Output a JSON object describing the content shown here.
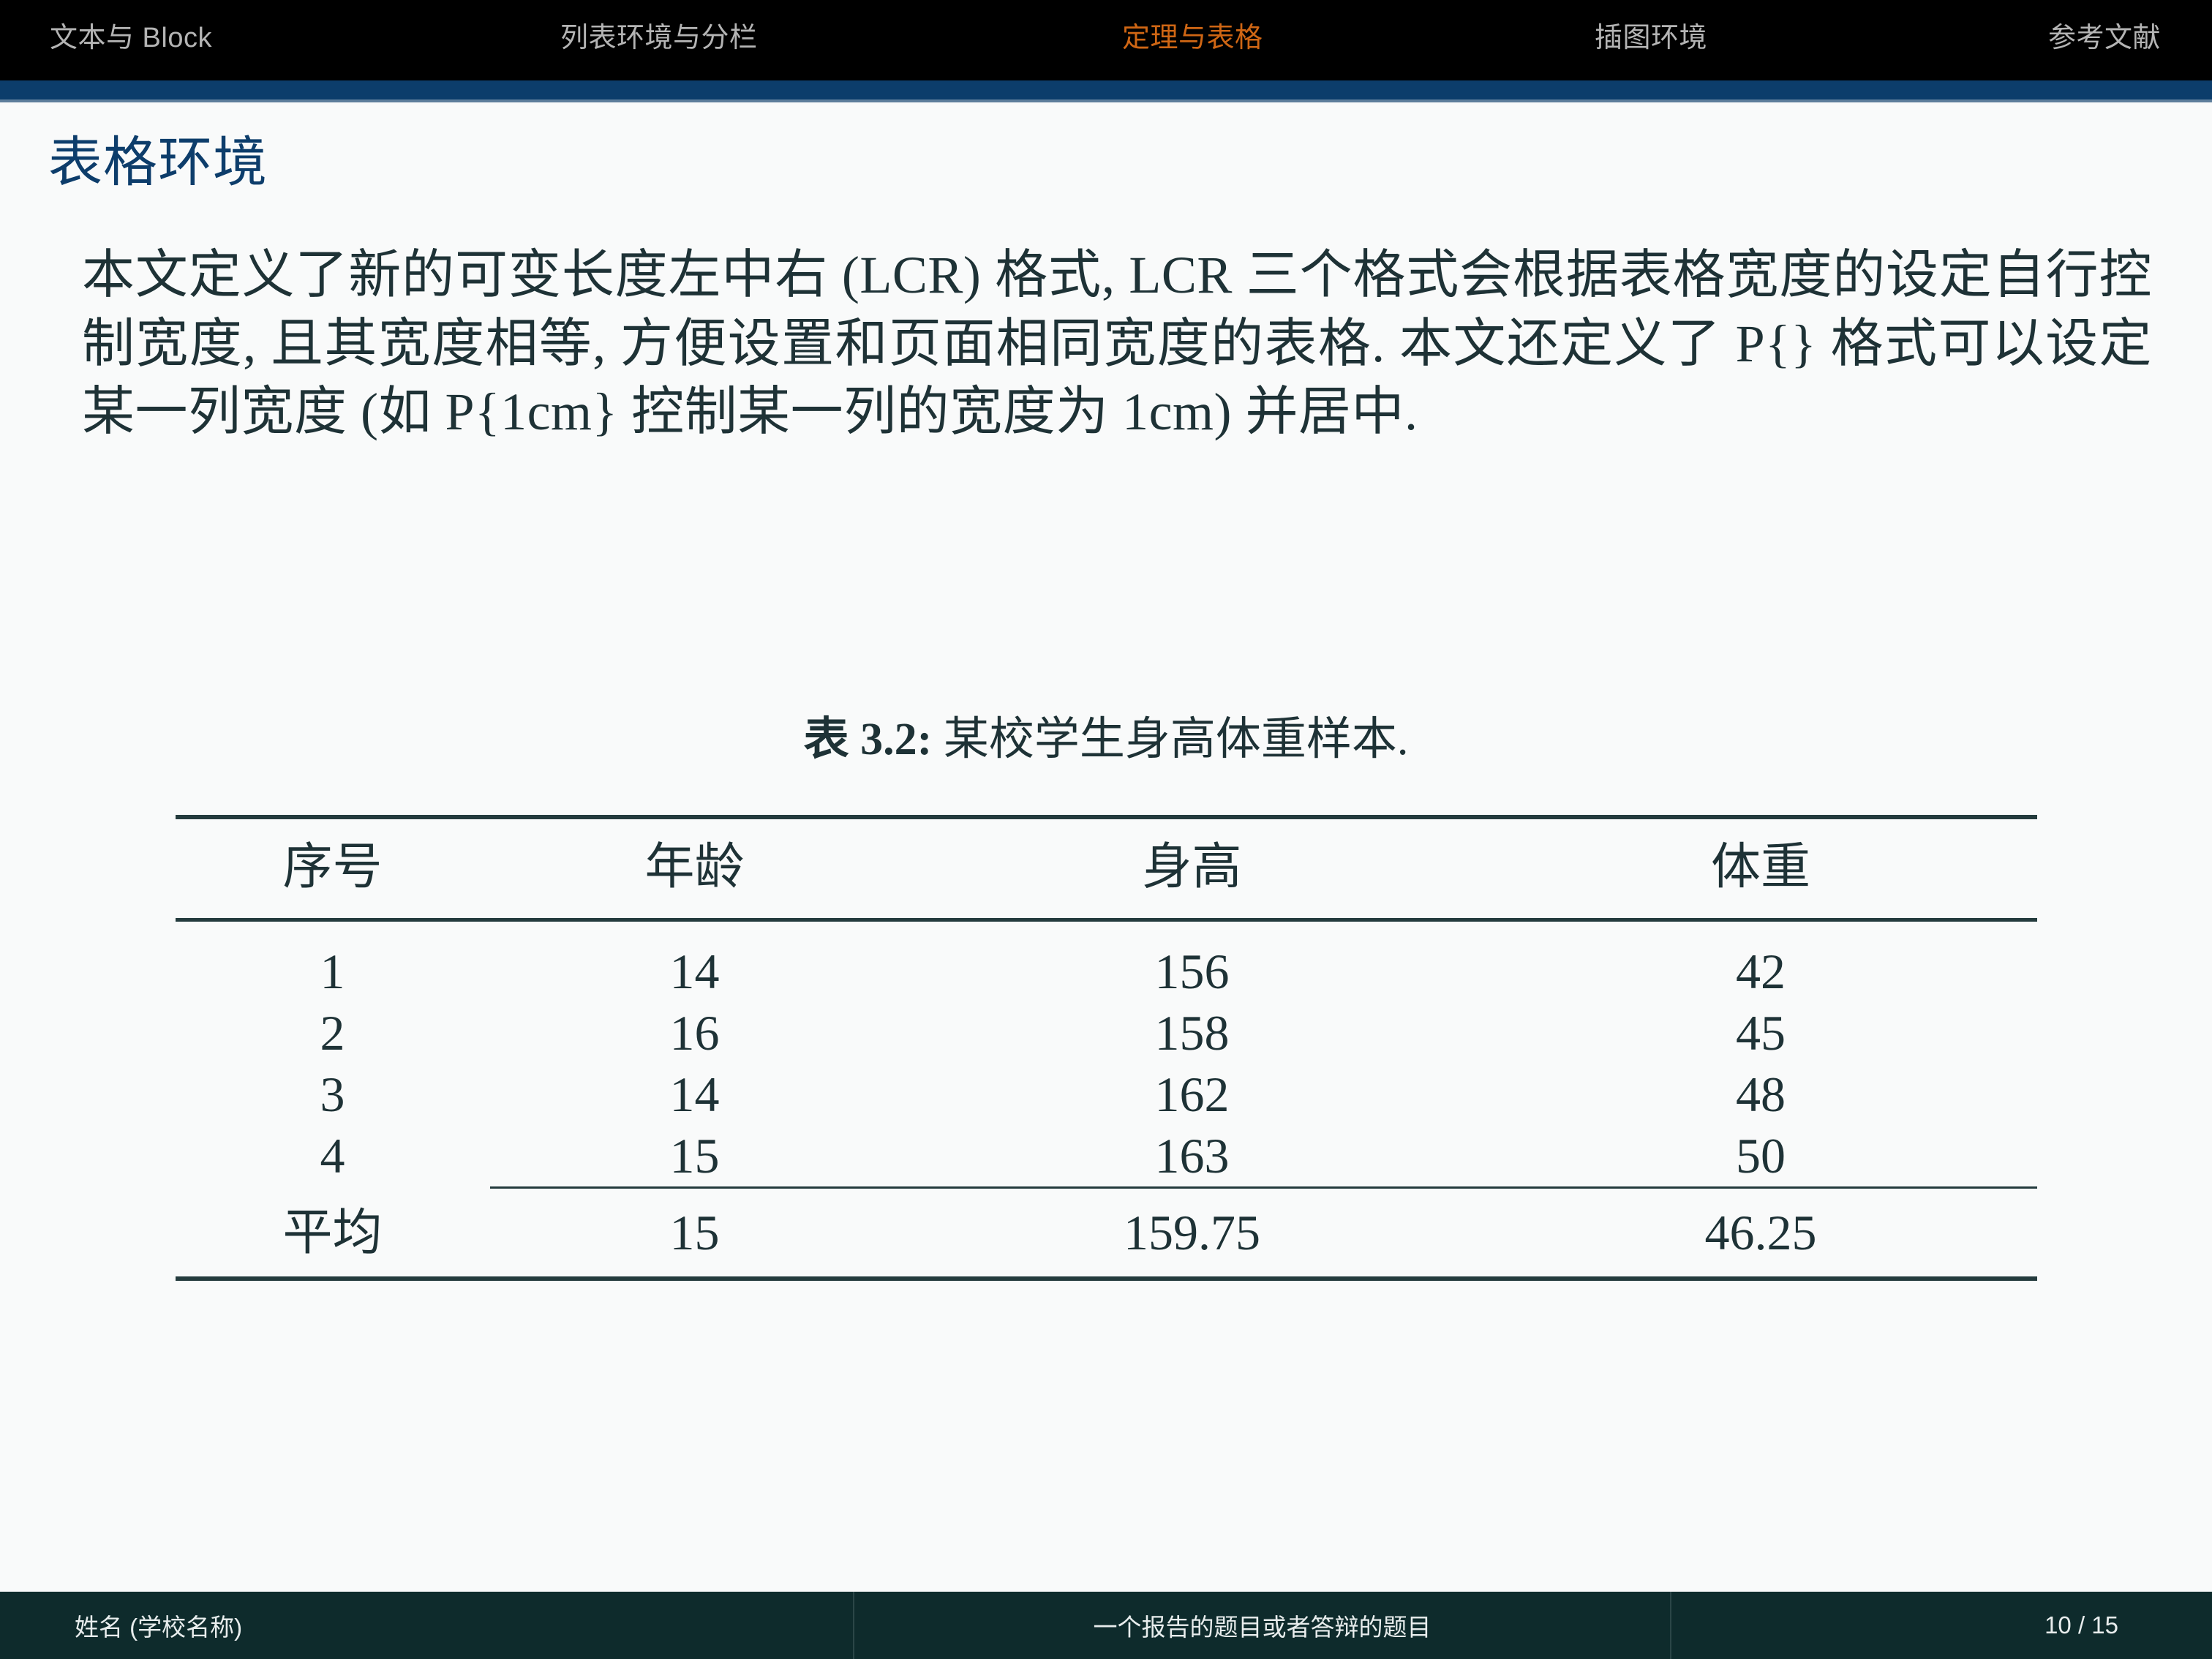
{
  "nav": {
    "items": [
      {
        "label": "文本与 Block",
        "active": false
      },
      {
        "label": "列表环境与分栏",
        "active": false
      },
      {
        "label": "定理与表格",
        "active": true
      },
      {
        "label": "插图环境",
        "active": false
      },
      {
        "label": "参考文献",
        "active": false
      }
    ],
    "accent_color": "#0C3D6B",
    "active_color": "#CF6614",
    "inactive_color": "#B4B4B4"
  },
  "frame": {
    "title": "表格环境",
    "title_color": "#0D3D6B",
    "paragraph": "本文定义了新的可变长度左中右 (LCR) 格式, LCR 三个格式会根据表格宽度的设定自行控制宽度, 且其宽度相等, 方便设置和页面相同宽度的表格. 本文还定义了 P{} 格式可以设定某一列宽度 (如 P{1cm} 控制某一列的宽度为 1cm) 并居中."
  },
  "table": {
    "caption_label": "表 3.2:",
    "caption_text": "某校学生身高体重样本.",
    "headers": [
      "序号",
      "年龄",
      "身高",
      "体重"
    ],
    "rows": [
      [
        "1",
        "14",
        "156",
        "42"
      ],
      [
        "2",
        "16",
        "158",
        "45"
      ],
      [
        "3",
        "14",
        "162",
        "48"
      ],
      [
        "4",
        "15",
        "163",
        "50"
      ]
    ],
    "summary_row": [
      "平均",
      "15",
      "159.75",
      "46.25"
    ],
    "rule_color": "#243B3D"
  },
  "footer": {
    "author": "姓名 (学校名称)",
    "title": "一个报告的题目或者答辩的题目",
    "page": "10 / 15",
    "background": "#0E2B2C"
  }
}
